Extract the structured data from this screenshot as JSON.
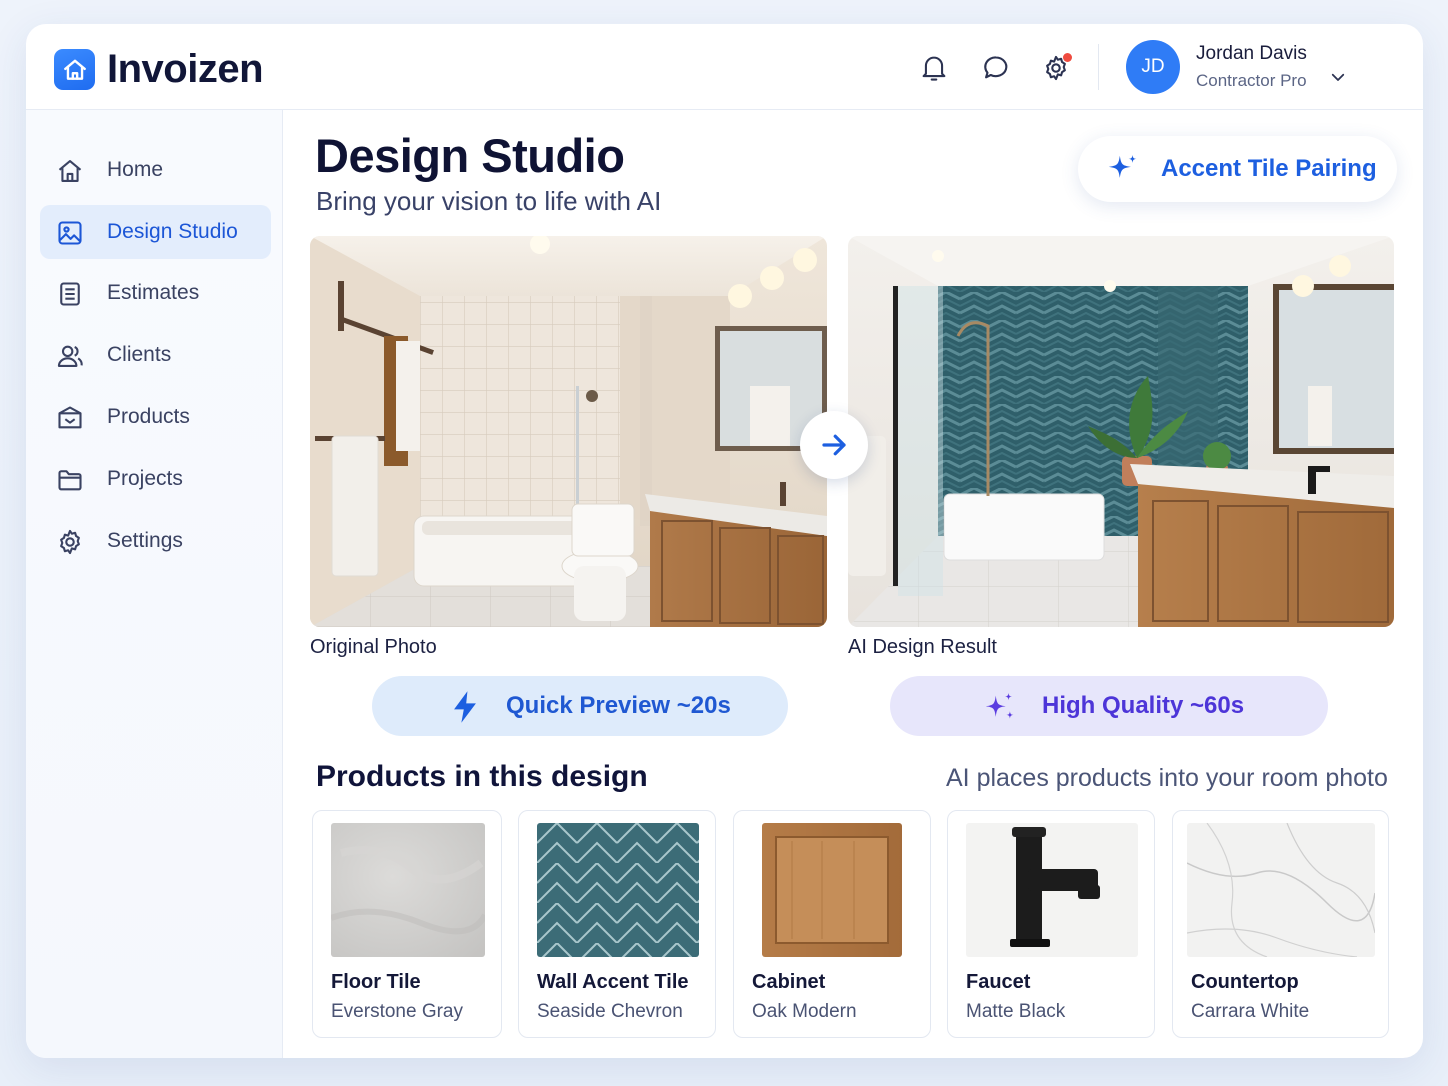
{
  "app": {
    "name": "Invoizen"
  },
  "header": {
    "user": {
      "initials": "JD",
      "name": "Jordan Davis",
      "role": "Contractor Pro"
    },
    "icons": [
      "bell-icon",
      "chat-icon",
      "gear-icon"
    ],
    "has_settings_notification": true
  },
  "sidebar": {
    "items": [
      {
        "label": "Home",
        "icon": "home-icon",
        "active": false
      },
      {
        "label": "Design Studio",
        "icon": "image-icon",
        "active": true
      },
      {
        "label": "Estimates",
        "icon": "document-icon",
        "active": false
      },
      {
        "label": "Clients",
        "icon": "users-icon",
        "active": false
      },
      {
        "label": "Products",
        "icon": "box-icon",
        "active": false
      },
      {
        "label": "Projects",
        "icon": "folder-icon",
        "active": false
      },
      {
        "label": "Settings",
        "icon": "gear-icon",
        "active": false
      }
    ]
  },
  "main": {
    "title": "Design Studio",
    "subtitle": "Bring your vision to life with AI",
    "accent_button": "Accent Tile Pairing",
    "original_caption": "Original Photo",
    "result_caption": "AI Design Result",
    "quick_preview": "Quick Preview ~20s",
    "high_quality": "High Quality ~60s",
    "products_title": "Products in this design",
    "products_note": "AI places products into your room photo",
    "products": [
      {
        "name": "Floor Tile",
        "variant": "Everstone Gray"
      },
      {
        "name": "Wall Accent Tile",
        "variant": "Seaside Chevron"
      },
      {
        "name": "Cabinet",
        "variant": "Oak Modern"
      },
      {
        "name": "Faucet",
        "variant": "Matte Black"
      },
      {
        "name": "Countertop",
        "variant": "Carrara White"
      }
    ]
  },
  "colors": {
    "accent": "#1d5fe0",
    "active_nav_bg": "#e3edfc",
    "quick_pill_bg": "#deebfb",
    "hq_pill_bg": "#e7e6fb",
    "hq_text": "#4d35d8",
    "notification": "#ef4b3f"
  }
}
